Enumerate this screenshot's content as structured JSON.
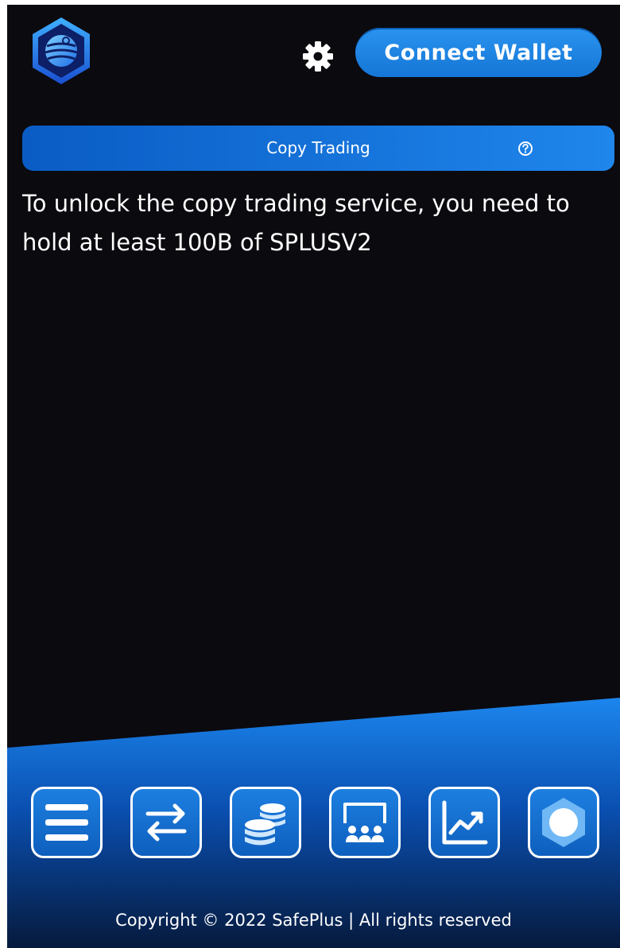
{
  "header": {
    "logo_icon": "globe-hexagon-logo",
    "settings_icon": "gear-icon",
    "connect_label": "Connect Wallet"
  },
  "tabbar": {
    "label": "Copy Trading",
    "help_icon": "question-circle-icon"
  },
  "main": {
    "message": "To unlock the copy trading service, you need to hold at least 100B of SPLUSV2"
  },
  "nav": {
    "items": [
      {
        "icon": "menu-icon"
      },
      {
        "icon": "swap-arrows-icon"
      },
      {
        "icon": "coins-stack-icon"
      },
      {
        "icon": "group-presentation-icon"
      },
      {
        "icon": "trending-chart-icon"
      },
      {
        "icon": "hexagon-circle-icon"
      }
    ]
  },
  "footer": {
    "copyright": "Copyright © 2022 SafePlus | All rights reserved"
  },
  "colors": {
    "background": "#0b0a0f",
    "accent_blue": "#1f86ec",
    "deep_blue": "#0a5cc4",
    "text": "#ffffff"
  }
}
